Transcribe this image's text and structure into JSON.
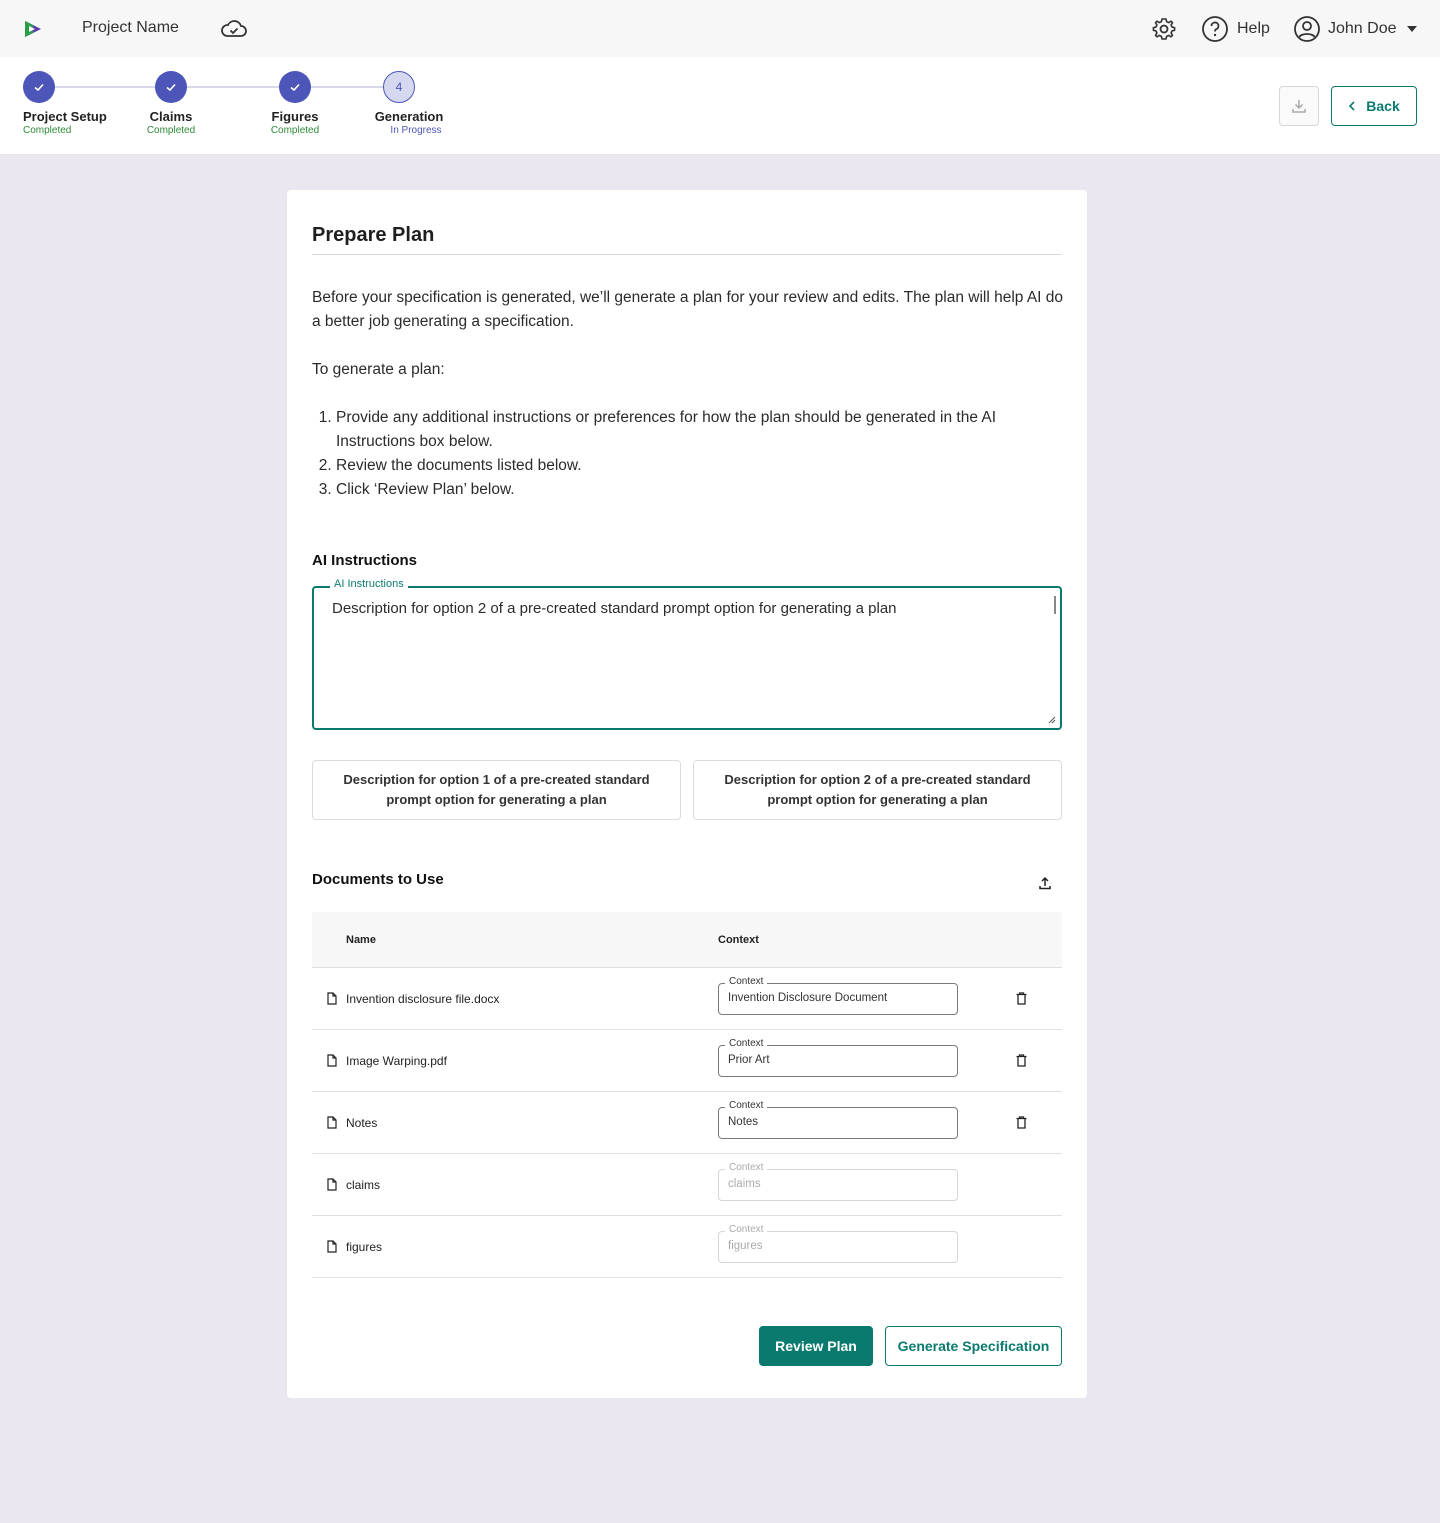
{
  "header": {
    "project_name": "Project Name",
    "help_label": "Help",
    "user_name": "John Doe"
  },
  "stepper": {
    "steps": [
      {
        "label": "Project Setup",
        "status": "Completed"
      },
      {
        "label": "Claims",
        "status": "Completed"
      },
      {
        "label": "Figures",
        "status": "Completed"
      },
      {
        "label": "Generation",
        "status": "In Progress",
        "number": "4"
      }
    ],
    "back_label": "Back"
  },
  "card": {
    "title": "Prepare Plan",
    "intro_paragraph": "Before your specification is generated, we’ll generate a plan for your review and edits. The plan will help AI do a better job generating a specification.",
    "steps_heading": "To generate a plan:",
    "steps": [
      "Provide any additional instructions or preferences for how the plan should be generated in the AI Instructions box below.",
      "Review the documents listed below.",
      "Click ‘Review Plan’ below."
    ],
    "ai_section_title": "AI Instructions",
    "ai_field_label": "AI Instructions",
    "ai_field_value": "Description for option 2 of a pre-created standard prompt option for generating a plan",
    "options": [
      "Description for option 1 of a pre-created standard prompt option for generating a plan",
      "Description for option 2 of a pre-created standard prompt option for generating a plan"
    ],
    "documents_title": "Documents to Use",
    "table": {
      "col_name": "Name",
      "col_context": "Context",
      "context_label": "Context",
      "rows": [
        {
          "name": "Invention disclosure file.docx",
          "context": "Invention Disclosure Document",
          "disabled": false
        },
        {
          "name": "Image Warping.pdf",
          "context": "Prior Art",
          "disabled": false
        },
        {
          "name": "Notes",
          "context": "Notes",
          "disabled": false
        },
        {
          "name": "claims",
          "context": "claims",
          "disabled": true
        },
        {
          "name": "figures",
          "context": "figures",
          "disabled": true
        }
      ]
    },
    "review_label": "Review Plan",
    "generate_label": "Generate Specification"
  },
  "colors": {
    "accent": "#0b7a6e",
    "step_blue": "#4c56b8",
    "completed_green": "#2e8b3a",
    "background": "#eae7f1"
  },
  "icons": [
    "app-logo-icon",
    "cloud-check-icon",
    "gear-icon",
    "help-circle-icon",
    "user-circle-icon",
    "chevron-down-icon",
    "download-icon",
    "chevron-left-icon",
    "upload-icon",
    "file-icon",
    "trash-icon"
  ]
}
